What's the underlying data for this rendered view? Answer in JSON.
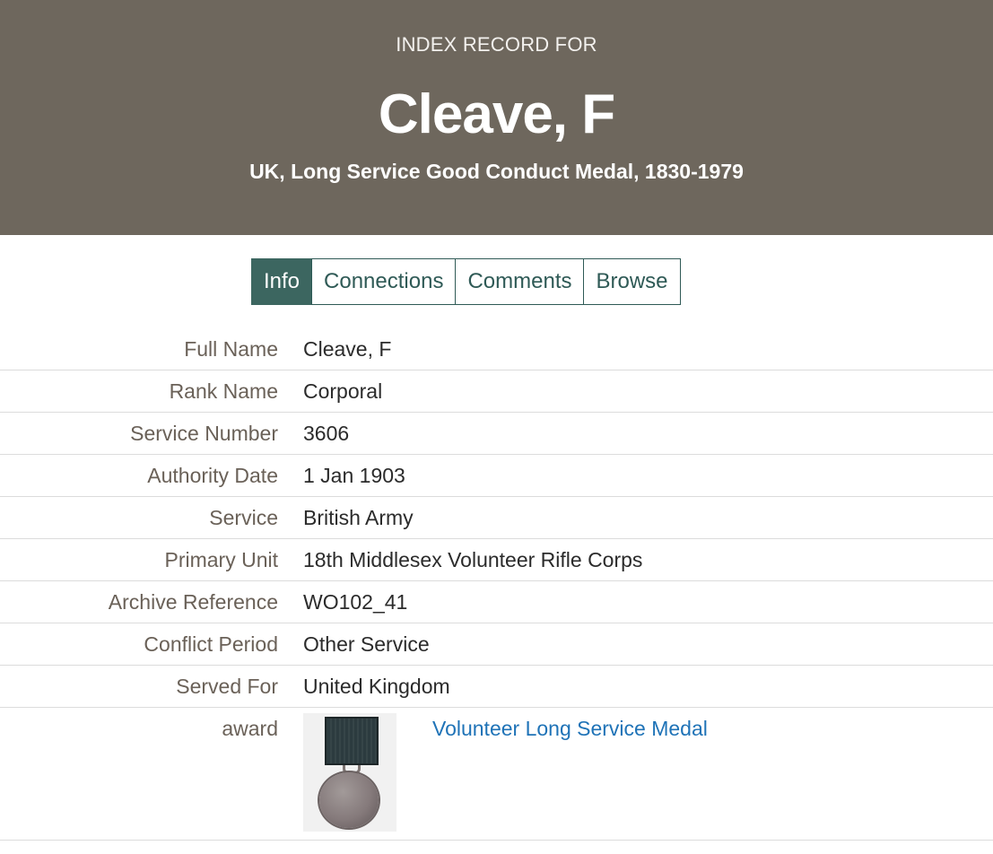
{
  "header": {
    "pre_title": "INDEX RECORD FOR",
    "title": "Cleave, F",
    "subtitle": "UK, Long Service Good Conduct Medal, 1830-1979",
    "background_color": "#6e675d"
  },
  "tabs": [
    {
      "label": "Info",
      "active": true
    },
    {
      "label": "Connections",
      "active": false
    },
    {
      "label": "Comments",
      "active": false
    },
    {
      "label": "Browse",
      "active": false
    }
  ],
  "fields": [
    {
      "label": "Full Name",
      "value": "Cleave, F"
    },
    {
      "label": "Rank Name",
      "value": "Corporal"
    },
    {
      "label": "Service Number",
      "value": "3606"
    },
    {
      "label": "Authority Date",
      "value": "1 Jan 1903"
    },
    {
      "label": "Service",
      "value": "British Army"
    },
    {
      "label": "Primary Unit",
      "value": "18th Middlesex Volunteer Rifle Corps"
    },
    {
      "label": "Archive Reference",
      "value": "WO102_41"
    },
    {
      "label": "Conflict Period",
      "value": "Other Service"
    },
    {
      "label": "Served For",
      "value": "United Kingdom"
    }
  ],
  "award": {
    "label": "award",
    "link_text": "Volunteer Long Service Medal",
    "image": "medal-image"
  },
  "colors": {
    "tab_accent": "#3c6660",
    "link": "#1f73b7"
  }
}
